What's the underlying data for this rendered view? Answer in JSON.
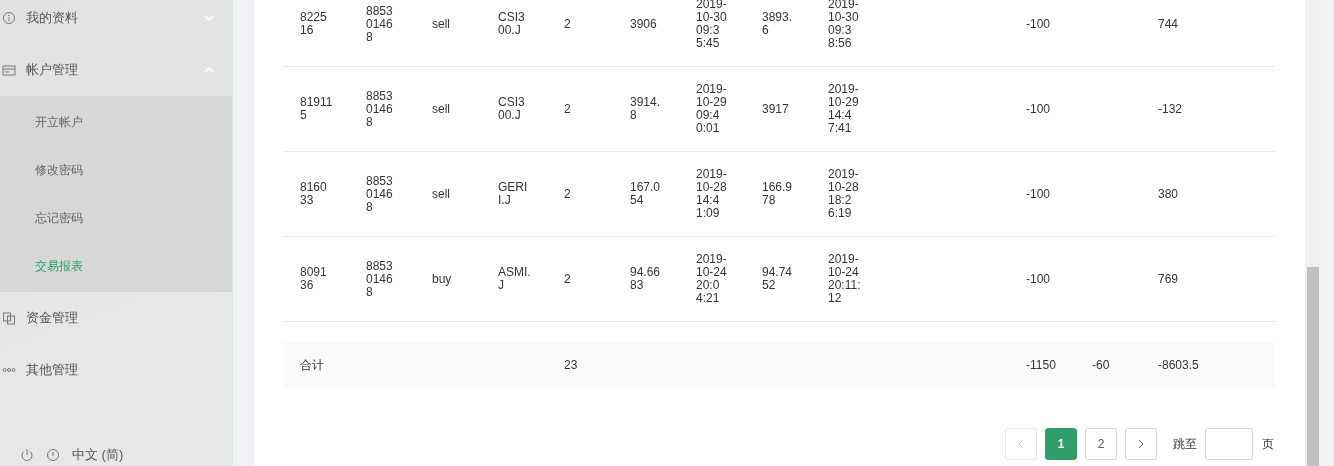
{
  "sidebar": {
    "items": [
      {
        "label": "我的资料",
        "expanded": false
      },
      {
        "label": "帐户管理",
        "expanded": true,
        "children": [
          {
            "label": "开立帐户",
            "selected": false
          },
          {
            "label": "修改密码",
            "selected": false
          },
          {
            "label": "忘记密码",
            "selected": false
          },
          {
            "label": "交易报表",
            "selected": true
          }
        ]
      },
      {
        "label": "资金管理"
      },
      {
        "label": "其他管理"
      }
    ],
    "language": "中文 (简)"
  },
  "table": {
    "rows": [
      {
        "column_1": "822516",
        "column_2": "885301468",
        "column_3": "sell",
        "column_4": "CSI300.J",
        "column_5": "2",
        "column_6": "3906",
        "column_7": "2019-10-30 09:35:45",
        "column_8": "3893.6",
        "column_9": "2019-10-30 09:38:56",
        "column_12": "-100",
        "column_14": "744"
      },
      {
        "column_1": "819115",
        "column_2": "885301468",
        "column_3": "sell",
        "column_4": "CSI300.J",
        "column_5": "2",
        "column_6": "3914.8",
        "column_7": "2019-10-29 09:40:01",
        "column_8": "3917",
        "column_9": "2019-10-29 14:47:41",
        "column_12": "-100",
        "column_14": "-132"
      },
      {
        "column_1": "816033",
        "column_2": "885301468",
        "column_3": "sell",
        "column_4": "GERII.J",
        "column_5": "2",
        "column_6": "167.054",
        "column_7": "2019-10-28 14:41:09",
        "column_8": "166.978",
        "column_9": "2019-10-28 18:26:19",
        "column_12": "-100",
        "column_14": "380"
      },
      {
        "column_1": "809136",
        "column_2": "885301468",
        "column_3": "buy",
        "column_4": "ASMI.J",
        "column_5": "2",
        "column_6": "94.6683",
        "column_7": "2019-10-24 20:04:21",
        "column_8": "94.7452",
        "column_9": "2019-10-24 20:11:12",
        "column_12": "-100",
        "column_14": "769"
      }
    ],
    "summary": {
      "column_1": "合计",
      "column_5": "23",
      "column_12": "-1150",
      "column_13": "-60",
      "column_14": "-8603.5"
    }
  },
  "pagination": {
    "prev": {
      "disabled": true
    },
    "pages": [
      {
        "label": "1",
        "selected": true
      },
      {
        "label": "2",
        "selected": false
      }
    ],
    "next": {
      "disabled": false
    },
    "jump_label": "跳至",
    "jump_suffix": "页"
  }
}
